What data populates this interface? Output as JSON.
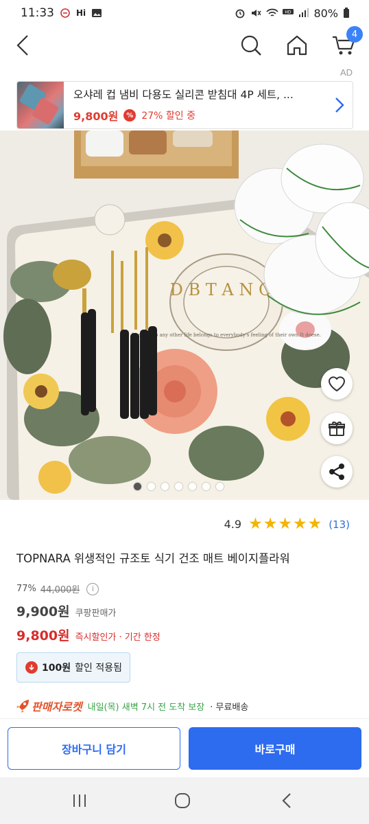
{
  "status_bar": {
    "time": "11:33",
    "hi_label": "Hi",
    "battery": "80%"
  },
  "top_nav": {
    "cart_count": "4"
  },
  "ad": {
    "label": "AD",
    "title": "오샤레 컵 냄비 다용도 실리콘 받침대 4P 세트, ...",
    "price": "9,800원",
    "pct_symbol": "%",
    "discount": "27% 할인 중"
  },
  "image_text": {
    "brand_letters": "D B T A N C I",
    "ring_text": "I belong to any other life belongs to everybody's feeling of their own.It doese."
  },
  "carousel": {
    "total": 7,
    "active": 0
  },
  "product": {
    "rating": "4.9",
    "rating_value": 4.9,
    "stars_filled": 5,
    "review_count": "(13)",
    "title": "TOPNARA 위생적인 규조토 식기 건조 매트 베이지플라워",
    "discount_rate": "77%",
    "original_price": "44,000원",
    "info_symbol": "i",
    "price": "9,900원",
    "price_label": "쿠팡판매가",
    "sale_price": "9,800원",
    "sale_label": "즉시할인가 · 기간 한정",
    "coupon_amount": "100원",
    "coupon_label": "할인 적용됨",
    "rocket_label": "판매자로켓",
    "delivery_date": "내일(목) 새벽 7시 전 도착 보장",
    "delivery_free": "· 무료배송"
  },
  "buttons": {
    "cart": "장바구니 담기",
    "buy": "바로구매"
  },
  "colors": {
    "accent": "#2d6bef",
    "sale": "#d92b2b",
    "star": "#f5b400",
    "delivery": "#3aa34a"
  }
}
